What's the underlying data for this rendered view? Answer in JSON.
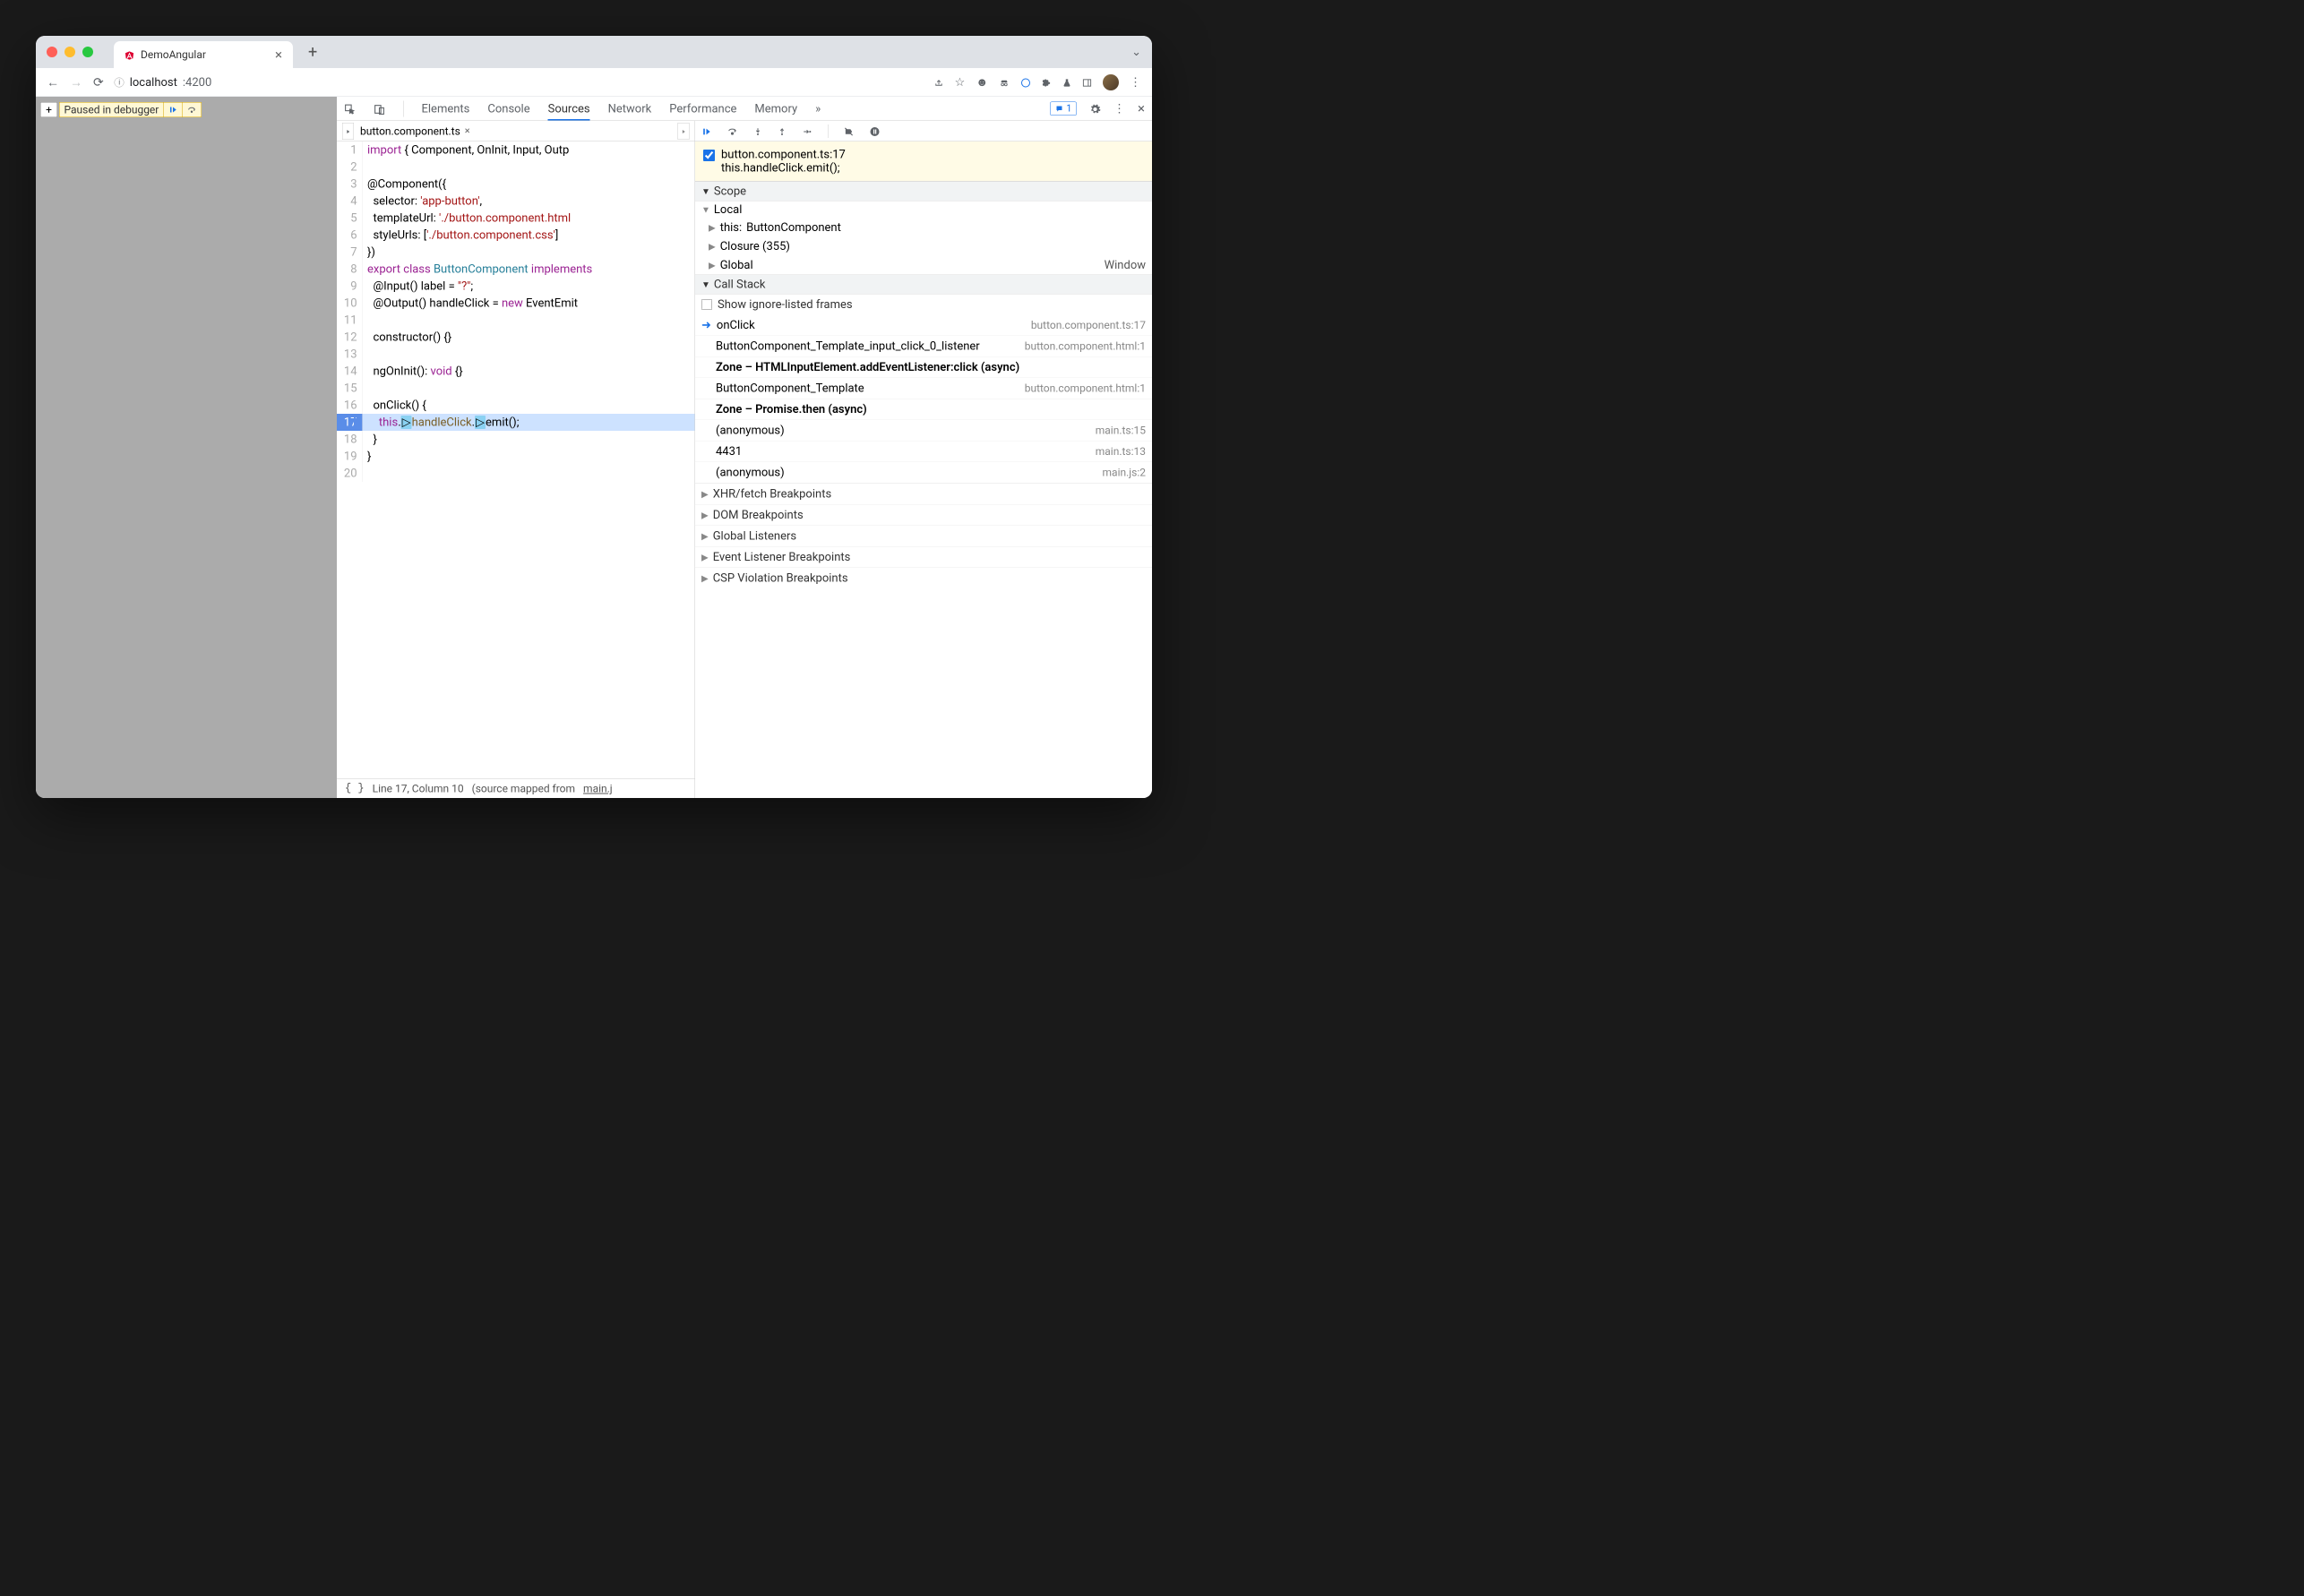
{
  "browser": {
    "tab_title": "DemoAngular",
    "url_host": "localhost",
    "url_port": ":4200",
    "paused_label": "Paused in debugger"
  },
  "devtools": {
    "tabs": [
      "Elements",
      "Console",
      "Sources",
      "Network",
      "Performance",
      "Memory"
    ],
    "active_tab": "Sources",
    "issues_count": "1",
    "file_tab": "button.component.ts",
    "status_line": "Line 17, Column 10",
    "status_mapped_prefix": "(source mapped from ",
    "status_mapped_link": "main.j"
  },
  "code": {
    "lines": [
      {
        "n": 1,
        "tokens": [
          {
            "t": "import",
            "c": "kw"
          },
          {
            "t": " { Component, OnInit, Input, Outp"
          }
        ]
      },
      {
        "n": 2,
        "tokens": []
      },
      {
        "n": 3,
        "tokens": [
          {
            "t": "@Component({"
          }
        ]
      },
      {
        "n": 4,
        "tokens": [
          {
            "t": "  selector: "
          },
          {
            "t": "'app-button'",
            "c": "str"
          },
          {
            "t": ","
          }
        ]
      },
      {
        "n": 5,
        "tokens": [
          {
            "t": "  templateUrl: "
          },
          {
            "t": "'./button.component.html",
            "c": "str"
          }
        ]
      },
      {
        "n": 6,
        "tokens": [
          {
            "t": "  styleUrls: ["
          },
          {
            "t": "'./button.component.css'",
            "c": "str"
          },
          {
            "t": "]"
          }
        ]
      },
      {
        "n": 7,
        "tokens": [
          {
            "t": "})"
          }
        ]
      },
      {
        "n": 8,
        "tokens": [
          {
            "t": "export",
            "c": "kw"
          },
          {
            "t": " "
          },
          {
            "t": "class",
            "c": "kw"
          },
          {
            "t": " "
          },
          {
            "t": "ButtonComponent",
            "c": "cls"
          },
          {
            "t": " "
          },
          {
            "t": "implements",
            "c": "kw"
          }
        ]
      },
      {
        "n": 9,
        "tokens": [
          {
            "t": "  @Input() label = "
          },
          {
            "t": "\"?\"",
            "c": "str"
          },
          {
            "t": ";"
          }
        ]
      },
      {
        "n": 10,
        "tokens": [
          {
            "t": "  @Output() handleClick = "
          },
          {
            "t": "new",
            "c": "kw"
          },
          {
            "t": " EventEmit"
          }
        ]
      },
      {
        "n": 11,
        "tokens": []
      },
      {
        "n": 12,
        "tokens": [
          {
            "t": "  constructor() {}"
          }
        ]
      },
      {
        "n": 13,
        "tokens": []
      },
      {
        "n": 14,
        "tokens": [
          {
            "t": "  ngOnInit(): "
          },
          {
            "t": "void",
            "c": "kw"
          },
          {
            "t": " {}"
          }
        ]
      },
      {
        "n": 15,
        "tokens": []
      },
      {
        "n": 16,
        "tokens": [
          {
            "t": "  onClick() {"
          }
        ]
      },
      {
        "n": 17,
        "hl": true,
        "tokens": [
          {
            "t": "    "
          },
          {
            "t": "this",
            "c": "kw"
          },
          {
            "t": "."
          },
          {
            "t": "▷",
            "c": "marker"
          },
          {
            "t": "handleClick",
            "c": "prop"
          },
          {
            "t": "."
          },
          {
            "t": "▷",
            "c": "marker"
          },
          {
            "t": "emit();"
          }
        ]
      },
      {
        "n": 18,
        "tokens": [
          {
            "t": "  }"
          }
        ]
      },
      {
        "n": 19,
        "tokens": [
          {
            "t": "}"
          }
        ]
      },
      {
        "n": 20,
        "tokens": []
      }
    ]
  },
  "breakpoint": {
    "file_line": "button.component.ts:17",
    "code": "this.handleClick.emit();"
  },
  "scope": {
    "header": "Scope",
    "local": "Local",
    "this_label": "this:",
    "this_type": "ButtonComponent",
    "closure": "Closure (355)",
    "global_label": "Global",
    "global_value": "Window"
  },
  "callstack": {
    "header": "Call Stack",
    "show_ignore": "Show ignore-listed frames",
    "frames": [
      {
        "name": "onClick",
        "loc": "button.component.ts:17",
        "current": true
      },
      {
        "name": "ButtonComponent_Template_input_click_0_listener",
        "loc": "button.component.html:1"
      },
      {
        "name": "Zone – HTMLInputElement.addEventListener:click (async)",
        "async": true
      },
      {
        "name": "ButtonComponent_Template",
        "loc": "button.component.html:1"
      },
      {
        "name": "Zone – Promise.then (async)",
        "async": true
      },
      {
        "name": "(anonymous)",
        "loc": "main.ts:15"
      },
      {
        "name": "4431",
        "loc": "main.ts:13"
      },
      {
        "name": "(anonymous)",
        "loc": "main.js:2"
      }
    ]
  },
  "panels": [
    "XHR/fetch Breakpoints",
    "DOM Breakpoints",
    "Global Listeners",
    "Event Listener Breakpoints",
    "CSP Violation Breakpoints"
  ]
}
